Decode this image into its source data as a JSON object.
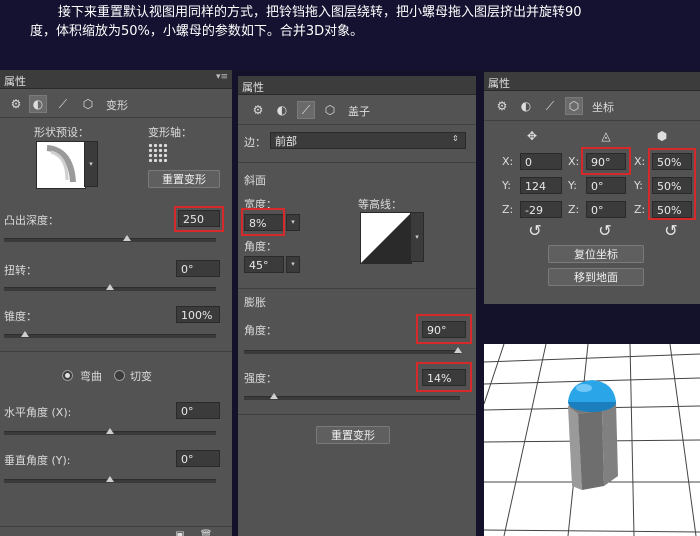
{
  "intro": {
    "line1": "接下来重置默认视图用同样的方式，把铃铛拖入图层绕转，把小螺母拖入图层挤出并旋转90",
    "line2": "度，体积缩放为50%，小螺母的参数如下。合并3D对象。"
  },
  "panel1": {
    "tab": "属性",
    "menu_glyph": "▾≡",
    "section": "变形",
    "shape_preset_label": "形状预设：",
    "deform_axis_label": "变形轴：",
    "reset_deform": "重置变形",
    "extrude_depth_label": "凸出深度：",
    "extrude_depth": "250",
    "twist_label": "扭转：",
    "twist": "0°",
    "taper_label": "锥度：",
    "taper": "100%",
    "bend_label": "弯曲",
    "shear_label": "切变",
    "h_angle_label": "水平角度 (X):",
    "h_angle": "0°",
    "v_angle_label": "垂直角度 (Y):",
    "v_angle": "0°",
    "extrude_slider_fraction": 0.58,
    "twist_slider_fraction": 0.5,
    "taper_slider_fraction": 0.1,
    "h_slider_fraction": 0.5,
    "v_slider_fraction": 0.5
  },
  "panel2": {
    "tab": "属性",
    "section": "盖子",
    "side_label": "边：",
    "side_value": "前部",
    "bevel_heading": "斜面",
    "width_label": "宽度：",
    "width": "8%",
    "contour_label": "等高线：",
    "angle_label": "角度：",
    "bevel_angle": "45°",
    "inflate_heading": "膨胀",
    "inflate_angle_label": "角度：",
    "inflate_angle": "90°",
    "strength_label": "强度：",
    "strength": "14%",
    "reset_deform": "重置变形",
    "inflate_angle_slider_fraction": 0.99,
    "strength_slider_fraction": 0.14
  },
  "panel3": {
    "tab": "属性",
    "section": "坐标",
    "x_label": "X:",
    "y_label": "Y:",
    "z_label": "Z:",
    "pos_x": "0",
    "pos_y": "124",
    "pos_z": "-29",
    "rot_x": "90°",
    "rot_y": "0°",
    "rot_z": "0°",
    "scale_x": "50%",
    "scale_y": "50%",
    "scale_z": "50%",
    "reset_coords": "复位坐标",
    "move_to_ground": "移到地面"
  },
  "colors": {
    "highlight": "#d62a2a",
    "panel_bg": "#535353",
    "page_bg": "#14122a",
    "cap_blue": "#2aa6e8"
  }
}
